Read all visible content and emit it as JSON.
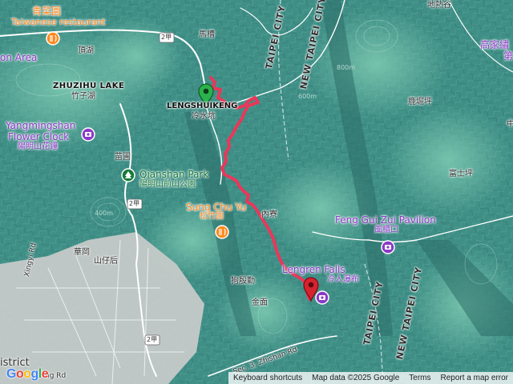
{
  "map": {
    "labels": {
      "qing_cai_yuan_zh": "青菜園",
      "qing_cai_yuan_en": "Taiwanese restaurant",
      "area_partial": "on Area",
      "ding_hu": "頂湖",
      "zhuzihu_lake": "ZHUZIHU LAKE",
      "zhu_zi_hu": "竹子湖",
      "yangmingshan_1": "Yangmingshan",
      "yangmingshan_2": "Flower Clock",
      "yangmingshan_zh": "陽明山花鐘",
      "miao_pu": "苗圃",
      "qianshan_en": "Qianshan Park",
      "qianshan_zh": "陽明山前山公園",
      "sung_chu_yu_en": "Sung Chu Yu",
      "sung_chu_yu_zh": "松竹園",
      "hua_gang": "華岡",
      "shan_zai_hou": "山仔后",
      "xingyi_rd": "Xingyi Rd",
      "district_partial": "istrict",
      "ma_cao": "馬槽",
      "lengshuikeng_en": "LENGSHUIKENG",
      "lengshuikeng_zh": "冷水坑",
      "taipei_city": "TAIPEI CITY",
      "new_taipei_city": "NEW TAIPEI CITY",
      "di_re_gu": "地熱谷",
      "lu_jue_ping": "鹿堀坪",
      "gao_jia_partial": "高家繡",
      "gao_jia_partial2": "第",
      "fu_shi_ping": "富士坪",
      "feng_gui_zui_en": "Feng Gui Zui Pavilion",
      "feng_gui_zui_zh": "風櫃口",
      "nei_liao": "內寮",
      "lengren_falls_en": "Lengren Falls",
      "lengren_falls_zh": "冷人瀑布",
      "gou_yin_dong": "狗殷勤",
      "jin_mian": "金面",
      "zhishan_rd": "Sec. 3, Zhishan Rd",
      "shore_partial": "ore",
      "zhong_partial": "中",
      "taipei_city_2": "TAIPEI CITY",
      "new_taipei_city_2": "NEW TAIPEI CITY",
      "route_2a_1": "2甲",
      "route_2a_2": "2甲",
      "route_2": "2甲",
      "route_2b": "2甲",
      "route_2c": "2甲",
      "ganglin_partial": "ng Rd",
      "contour_600": "600m",
      "contour_800": "800m",
      "contour_400": "400m"
    },
    "route_color": "#e8385a",
    "start_color": "#2bb24c",
    "end_color": "#d5232f"
  },
  "attribution": {
    "google": "Google",
    "keyboard_shortcuts": "Keyboard shortcuts",
    "map_data": "Map data ©2025 Google",
    "terms": "Terms",
    "report": "Report a map error"
  }
}
